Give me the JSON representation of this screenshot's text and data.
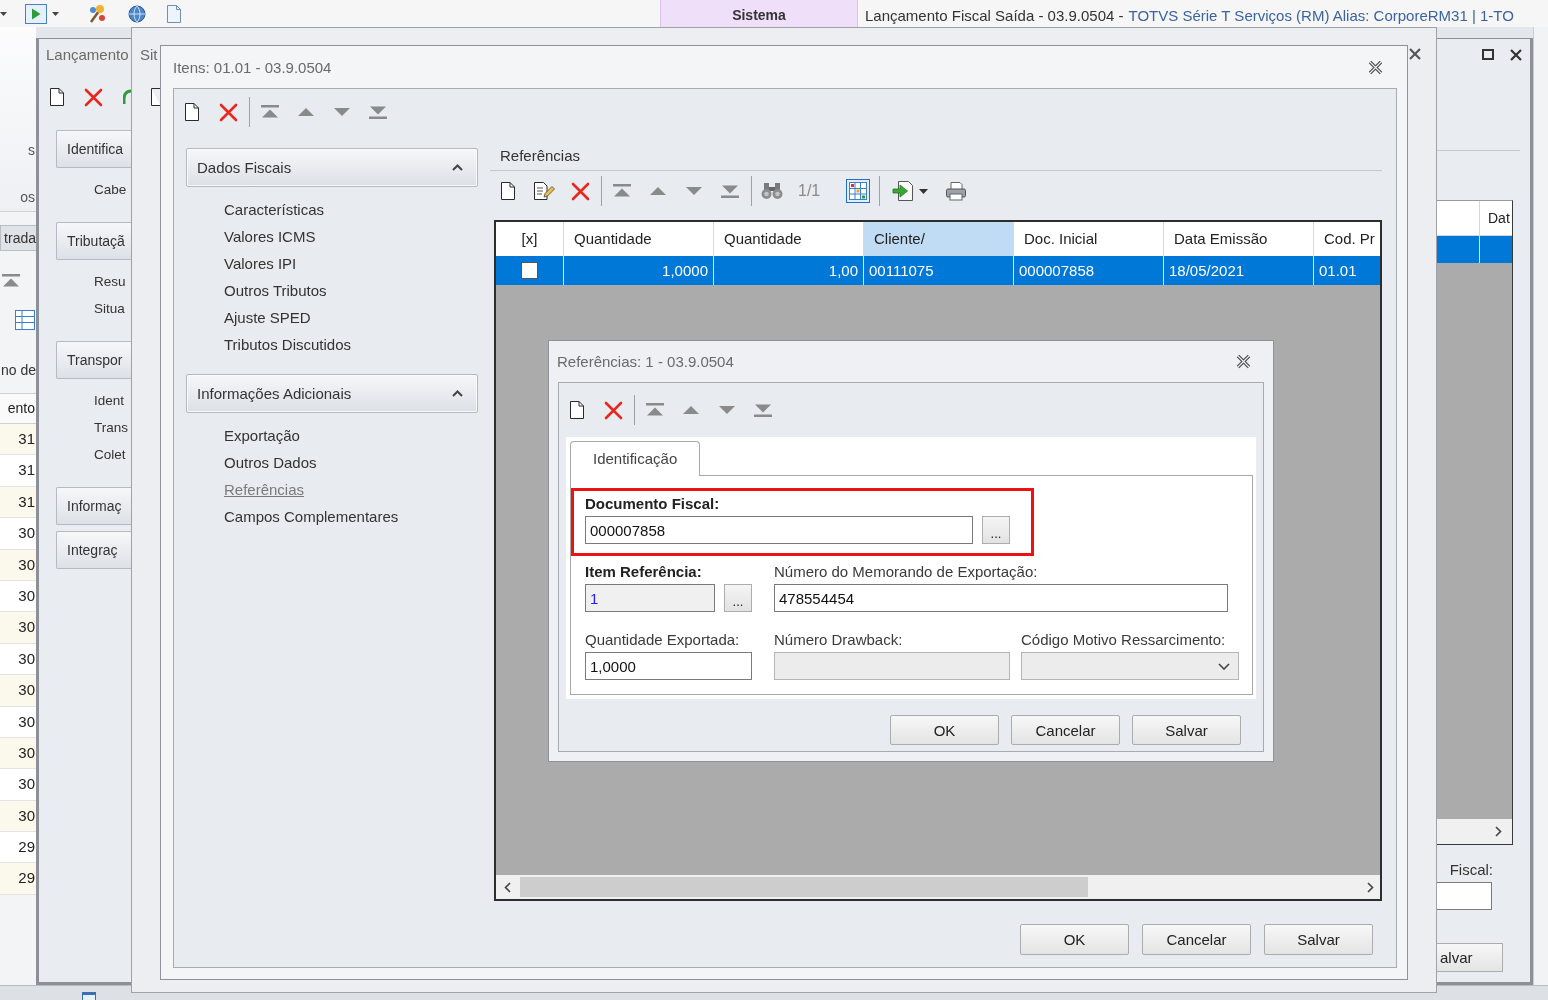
{
  "top_bar": {
    "ribbon_tab": "Sistema",
    "title": "Lançamento Fiscal Saída - 03.9.0504 -",
    "title_detail": "TOTVS Série T Serviços (RM) Alias: CorporeRM31 | 1-TO"
  },
  "side_list": {
    "ribbon_labels": [
      "s",
      "os"
    ],
    "tab": "trada",
    "group_label": "no de",
    "column": "ento",
    "cells": [
      "31",
      "31",
      "31",
      "30",
      "30",
      "30",
      "30",
      "30",
      "30",
      "30",
      "30",
      "30",
      "30",
      "29",
      "29"
    ]
  },
  "launch_window": {
    "title": "Lançamento",
    "sections": [
      {
        "label": "Identifica",
        "items": [
          "Cabe"
        ]
      },
      {
        "label": "Tributaçã",
        "items": [
          "Resu",
          "Situa"
        ]
      },
      {
        "label": "Transpor",
        "items": [
          "Ident",
          "Trans",
          "Colet"
        ]
      },
      {
        "label": "Informaç"
      },
      {
        "label": "Integraç"
      }
    ],
    "grid": {
      "column": "Dat",
      "rows": [
        {
          "selected": true
        }
      ]
    },
    "field_label": "Fiscal:",
    "button": "alvar"
  },
  "status_window": {
    "title": "Sit"
  },
  "items_window": {
    "title": "Itens: 01.01 - 03.9.0504",
    "sections": [
      {
        "label": "Dados Fiscais",
        "expanded": true,
        "items": [
          {
            "label": "Características",
            "selected": false
          },
          {
            "label": "Valores ICMS",
            "selected": false
          },
          {
            "label": "Valores IPI",
            "selected": false
          },
          {
            "label": "Outros Tributos",
            "selected": false
          },
          {
            "label": "Ajuste SPED",
            "selected": false
          },
          {
            "label": "Tributos Discutidos",
            "selected": false
          }
        ]
      },
      {
        "label": "Informações Adicionais",
        "expanded": true,
        "items": [
          {
            "label": "Exportação",
            "selected": false
          },
          {
            "label": "Outros Dados",
            "selected": false
          },
          {
            "label": "Referências",
            "selected": true
          },
          {
            "label": "Campos Complementares",
            "selected": false
          }
        ]
      }
    ],
    "group_title": "Referências",
    "record_counter": "1/1",
    "grid": {
      "columns": [
        {
          "label": "[x]",
          "selected": false
        },
        {
          "label": "Quantidade",
          "selected": false
        },
        {
          "label": "Quantidade",
          "selected": false
        },
        {
          "label": "Cliente/",
          "selected": true
        },
        {
          "label": "Doc. Inicial",
          "selected": false
        },
        {
          "label": "Data Emissão",
          "selected": false
        },
        {
          "label": "Cod. Pr",
          "selected": false
        }
      ],
      "rows": [
        {
          "selected": true,
          "checked": false,
          "cells": [
            "",
            "1,0000",
            "1,00",
            "00111075",
            "000007858",
            "18/05/2021",
            "01.01"
          ]
        }
      ]
    },
    "buttons": [
      "OK",
      "Cancelar",
      "Salvar"
    ]
  },
  "reference_dialog": {
    "title": "Referências: 1 - 03.9.0504",
    "tabs": [
      {
        "label": "Identificação",
        "selected": true
      }
    ],
    "rows": [
      {
        "highlighted": true,
        "fields": [
          {
            "kind": "lookup",
            "label": "Documento Fiscal:",
            "required": true,
            "readonly": false,
            "disabled": false,
            "value": "000007858",
            "button": "..."
          }
        ]
      },
      {
        "highlighted": false,
        "fields": [
          {
            "kind": "lookup",
            "label": "Item Referência:",
            "required": true,
            "readonly": true,
            "disabled": false,
            "value": "1",
            "button": "..."
          },
          {
            "kind": "text",
            "label": "Número do Memorando de Exportação:",
            "required": false,
            "readonly": false,
            "disabled": false,
            "value": "478554454"
          }
        ]
      },
      {
        "highlighted": false,
        "fields": [
          {
            "kind": "text",
            "label": "Quantidade Exportada:",
            "required": false,
            "readonly": false,
            "disabled": false,
            "value": "1,0000"
          },
          {
            "kind": "text",
            "label": "Número Drawback:",
            "required": false,
            "readonly": false,
            "disabled": true
          },
          {
            "kind": "select",
            "label": "Código Motivo Ressarcimento:",
            "required": false,
            "readonly": false,
            "disabled": true
          }
        ]
      }
    ],
    "buttons": [
      "OK",
      "Cancelar",
      "Salvar"
    ]
  }
}
